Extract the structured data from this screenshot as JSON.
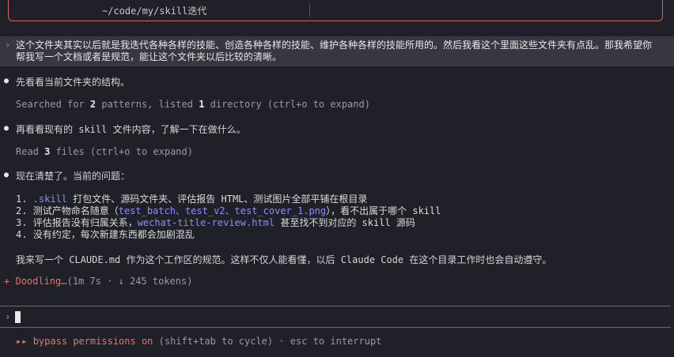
{
  "top": {
    "path": "~/code/my/skill迭代"
  },
  "user_message": {
    "caret": "›",
    "text": "这个文件夹其实以后就是我迭代各种各样的技能、创造各种各样的技能、维护各种各样的技能所用的。然后我看这个里面这些文件夹有点乱。那我希望你帮我写一个文档或者是规范，能让这个文件夹以后比较的清晰。"
  },
  "entries": {
    "e1_title": "先看看当前文件夹的结构。",
    "e1_detail_pre": "Searched for ",
    "e1_detail_n1": "2",
    "e1_detail_mid": " patterns, listed ",
    "e1_detail_n2": "1",
    "e1_detail_post": " directory (ctrl+o to expand)",
    "e2_title": "再看看现有的 skill 文件内容，了解一下在做什么。",
    "e2_detail_pre": "Read ",
    "e2_detail_n": "3",
    "e2_detail_post": " files (ctrl+o to expand)",
    "e3_title": "现在清楚了。当前的问题：",
    "list": {
      "i1_num": "1. ",
      "i1_link": ".skill",
      "i1_rest": " 打包文件、源码文件夹、评估报告 HTML、测试图片全部平铺在根目录",
      "i2_num": "2. ",
      "i2_pre": "测试产物命名随意（",
      "i2_link": "test_batch、test_v2、test_cover_1.png",
      "i2_post": "），看不出属于哪个 skill",
      "i3_num": "3. ",
      "i3_pre": "评估报告没有归属关系，",
      "i3_link": "wechat-title-review.html",
      "i3_post": " 甚至找不到对应的 skill 源码",
      "i4_num": "4. ",
      "i4_text": "没有约定，每次新建东西都会加剧混乱"
    },
    "closing": "我来写一个 CLAUDE.md 作为这个工作区的规范。这样不仅人能看懂，以后 Claude Code 在这个目录工作时也会自动遵守。"
  },
  "status": {
    "symbol": "+",
    "label": "Doodling…",
    "meta": "(1m 7s · ↓ 245 tokens)"
  },
  "prompt": {
    "caret": "›"
  },
  "footer": {
    "icon": "▸▸",
    "mode": "bypass permissions on",
    "hint": " (shift+tab to cycle) · esc to interrupt"
  },
  "colors": {
    "accent": "#e0786a",
    "link": "#8b8ff7",
    "background": "#1f2028"
  }
}
